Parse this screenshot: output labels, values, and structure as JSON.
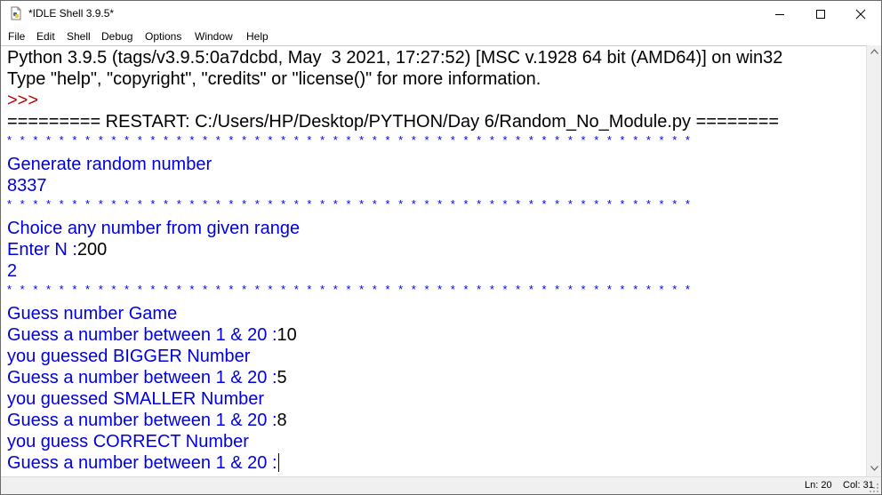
{
  "window": {
    "title": "*IDLE Shell 3.9.5*",
    "icon": "python-file-icon"
  },
  "menu": [
    "File",
    "Edit",
    "Shell",
    "Debug",
    "Options",
    "Window",
    "Help"
  ],
  "shell": {
    "banner_1": "Python 3.9.5 (tags/v3.9.5:0a7dcbd, May  3 2021, 17:27:52) [MSC v.1928 64 bit (AMD64)] on win32",
    "banner_2": "Type \"help\", \"copyright\", \"credits\" or \"license()\" for more information.",
    "prompt": ">>>",
    "restart": "========= RESTART: C:/Users/HP/Desktop/PYTHON/Day 6/Random_No_Module.py ========",
    "stars": "* * * * * * * * * * * * * * * * * * * * * * * * * * * * * * * * * * * * * * * * * * * * * * * * * * * * *",
    "gen_heading": "Generate random number",
    "gen_value": "8337",
    "choice_heading": "Choice any number from given range",
    "enter_prompt": "Enter N :",
    "enter_value": "200",
    "choice_value": "2",
    "guess_heading": "Guess number Game",
    "guess_prompt": "Guess a number between 1 & 20 :",
    "guess_1": "10",
    "result_1": "you guessed BIGGER Number",
    "guess_2": "5",
    "result_2": "you guessed SMALLER Number",
    "guess_3": "8",
    "result_3": "you guess CORRECT Number"
  },
  "status": {
    "line": "Ln: 20",
    "column": "Col: 31"
  },
  "colors": {
    "output_blue": "#0000dd",
    "prompt_red": "#c00000"
  }
}
